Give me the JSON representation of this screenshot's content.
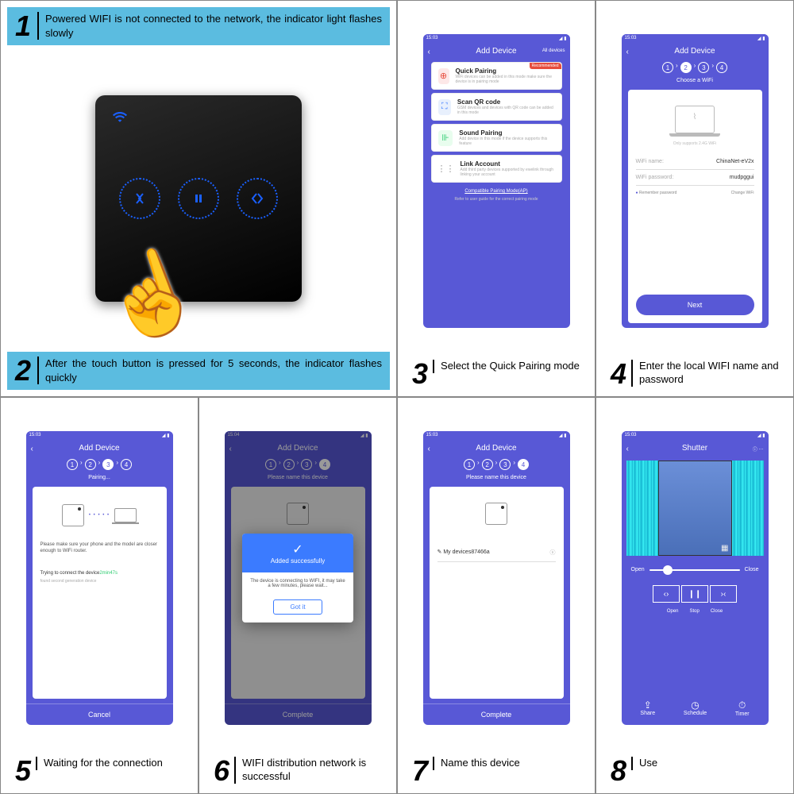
{
  "steps": {
    "s1": {
      "num": "1",
      "text": "Powered WIFI is not connected to the network, the indicator light flashes slowly"
    },
    "s2": {
      "num": "2",
      "text": "After the touch button is pressed for 5 seconds, the indicator flashes quickly"
    },
    "s3": {
      "num": "3",
      "text": "Select the Quick Pairing mode"
    },
    "s4": {
      "num": "4",
      "text": "Enter the local WIFI name and password"
    },
    "s5": {
      "num": "5",
      "text": "Waiting for the connection"
    },
    "s6": {
      "num": "6",
      "text": "WIFI distribution network is successful"
    },
    "s7": {
      "num": "7",
      "text": "Name this device"
    },
    "s8": {
      "num": "8",
      "text": "Use"
    }
  },
  "phone3": {
    "time": "15:03",
    "title": "Add Device",
    "all": "All devices",
    "opt1": {
      "title": "Quick Pairing",
      "desc": "WiFi devices can be added in this mode make sure the device is in pairing mode",
      "badge": "Recommended"
    },
    "opt2": {
      "title": "Scan QR code",
      "desc": "GSM devices and devices with QR code can be added in this mode"
    },
    "opt3": {
      "title": "Sound Pairing",
      "desc": "Add device in this mode if the device supports this feature"
    },
    "opt4": {
      "title": "Link Account",
      "desc": "Add third party devices supported by ewelink through linking your account"
    },
    "compat": "Compatible Pairing Mode(AP)",
    "refer": "Refer to user guide for the correct pairing mode"
  },
  "phone4": {
    "time": "15:03",
    "title": "Add Device",
    "sub": "Choose a WiFi",
    "support": "Only supports 2.4G WiFi",
    "name_label": "WiFi name:",
    "name_val": "ChinaNet-eV2x",
    "pwd_label": "WiFi password:",
    "pwd_val": "mudpggui",
    "remember": "Remember password",
    "change": "Change WiFi",
    "next": "Next"
  },
  "phone5": {
    "time": "15:03",
    "title": "Add Device",
    "sub": "Pairing...",
    "msg": "Please make sure your phone and the model are closer enough to WiFi router.",
    "trying": "Trying to connect the device",
    "timer": "2min47s",
    "found": "found second generation device",
    "cancel": "Cancel"
  },
  "phone6": {
    "time": "15:04",
    "title": "Add Device",
    "sub": "Please name this device",
    "modal_title": "Added successfully",
    "modal_body": "The device is connecting to WIFI, it may take a few minutes, please wait...",
    "modal_btn": "Got it",
    "complete": "Complete"
  },
  "phone7": {
    "time": "15:03",
    "title": "Add Device",
    "sub": "Please name this device",
    "devname": "My devices87466a",
    "complete": "Complete"
  },
  "phone8": {
    "time": "15:03",
    "title": "Shutter",
    "open": "Open",
    "close": "Close",
    "b1": "Open",
    "b2": "Stop",
    "b3": "Close",
    "share": "Share",
    "schedule": "Schedule",
    "timer": "Timer"
  }
}
